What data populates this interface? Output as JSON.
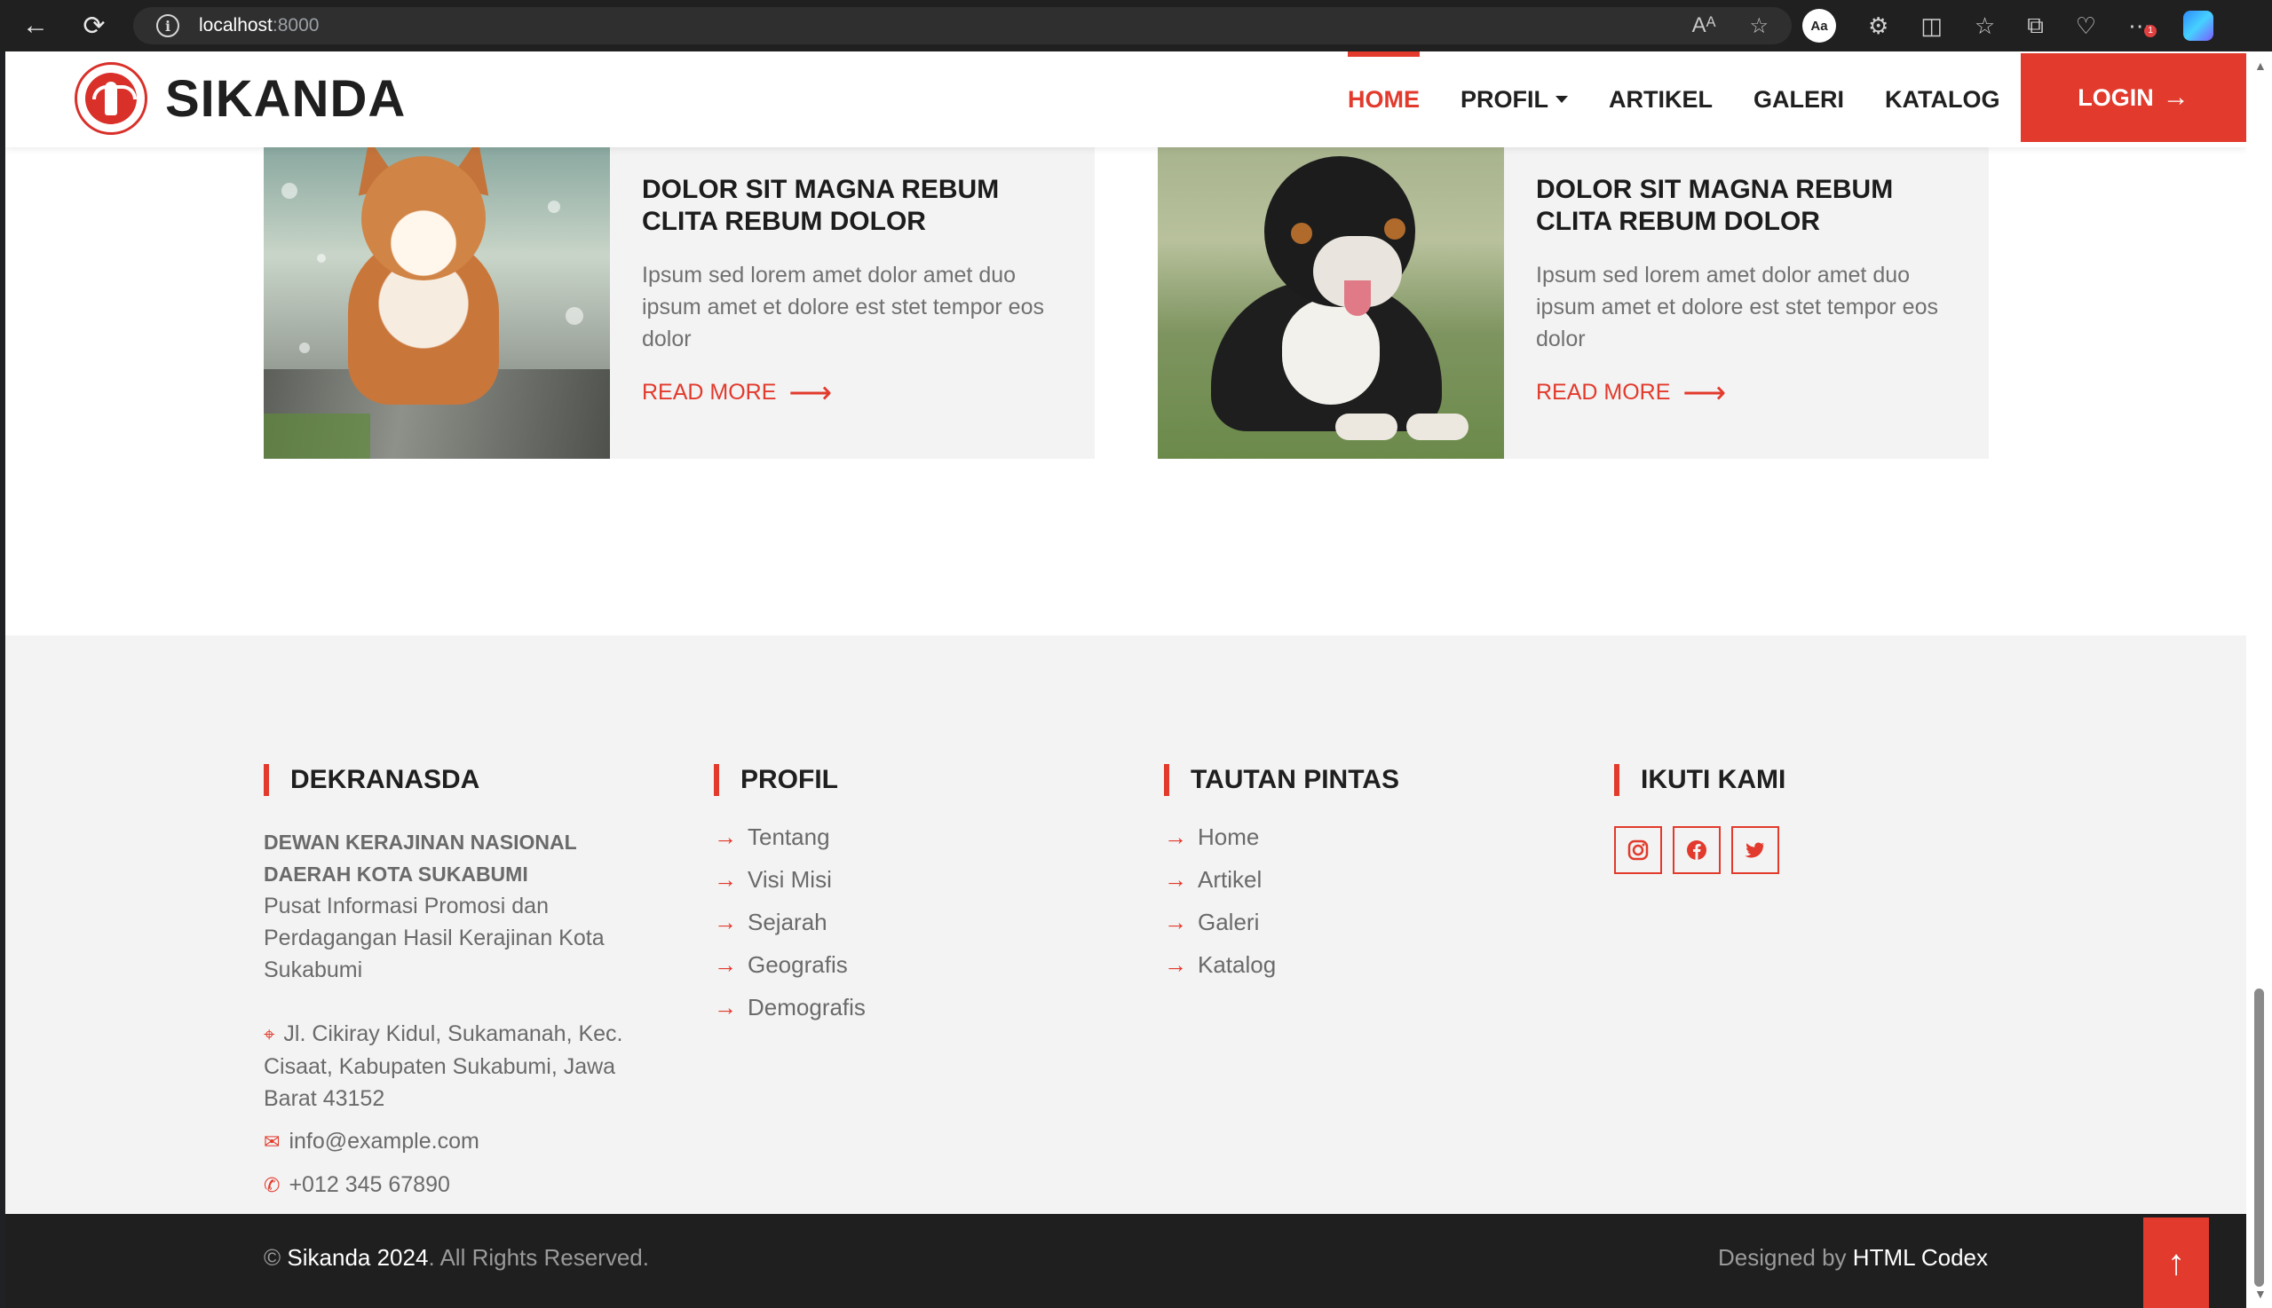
{
  "browser": {
    "url_host": "localhost",
    "url_port": ":8000",
    "reader_label": "Aa",
    "notification_count": "1"
  },
  "navbar": {
    "brand": "SIKANDA",
    "menu": [
      {
        "label": "HOME",
        "active": true
      },
      {
        "label": "PROFIL",
        "dropdown": true
      },
      {
        "label": "ARTIKEL"
      },
      {
        "label": "GALERI"
      },
      {
        "label": "KATALOG"
      }
    ],
    "login_label": "LOGIN",
    "login_arrow": "→"
  },
  "articles": [
    {
      "title": "DOLOR SIT MAGNA REBUM CLITA REBUM DOLOR",
      "desc": "Ipsum sed lorem amet dolor amet duo ipsum amet et dolore est stet tempor eos dolor",
      "more": "READ MORE"
    },
    {
      "title": "DOLOR SIT MAGNA REBUM CLITA REBUM DOLOR",
      "desc": "Ipsum sed lorem amet dolor amet duo ipsum amet et dolore est stet tempor eos dolor",
      "more": "READ MORE"
    }
  ],
  "footer": {
    "col1": {
      "heading": "DEKRANASDA",
      "org": "DEWAN KERAJINAN NASIONAL DAERAH KOTA SUKABUMI",
      "tagline": "Pusat Informasi Promosi dan Perdagangan Hasil Kerajinan Kota Sukabumi",
      "address": "Jl. Cikiray Kidul, Sukamanah, Kec. Cisaat, Kabupaten Sukabumi, Jawa Barat 43152",
      "email": "info@example.com",
      "phone": "+012 345 67890"
    },
    "col2": {
      "heading": "PROFIL",
      "links": [
        "Tentang",
        "Visi Misi",
        "Sejarah",
        "Geografis",
        "Demografis"
      ]
    },
    "col3": {
      "heading": "TAUTAN PINTAS",
      "links": [
        "Home",
        "Artikel",
        "Galeri",
        "Katalog"
      ]
    },
    "col4": {
      "heading": "IKUTI KAMI",
      "social": [
        "instagram-icon",
        "facebook-icon",
        "twitter-icon"
      ]
    }
  },
  "bottom": {
    "copy_symbol": "©",
    "copy_brand": "Sikanda 2024",
    "copy_rest": ". All Rights Reserved.",
    "designed_by": "Designed by",
    "designer": "HTML Codex"
  },
  "colors": {
    "accent": "#e23a2c",
    "footer_bg": "#f3f3f3",
    "bottom_bg": "#1f1f1f"
  }
}
